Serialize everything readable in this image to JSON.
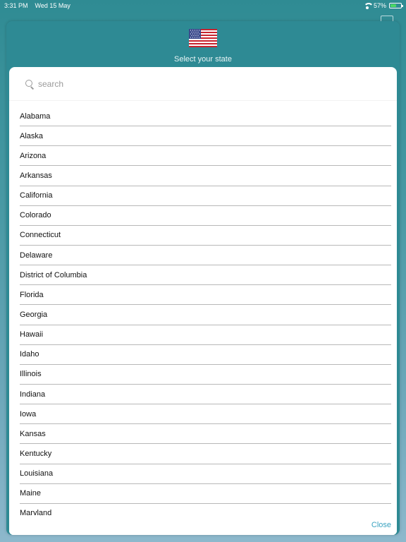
{
  "status_bar": {
    "time": "3:31 PM",
    "date": "Wed 15 May",
    "battery": "57%",
    "battery_level": 0.57
  },
  "modal": {
    "title": "Select your state",
    "flag_icon": "us-flag-icon"
  },
  "search": {
    "placeholder": "search",
    "value": ""
  },
  "states": [
    "Alabama",
    "Alaska",
    "Arizona",
    "Arkansas",
    "California",
    "Colorado",
    "Connecticut",
    "Delaware",
    "District of Columbia",
    "Florida",
    "Georgia",
    "Hawaii",
    "Idaho",
    "Illinois",
    "Indiana",
    "Iowa",
    "Kansas",
    "Kentucky",
    "Louisiana",
    "Maine",
    "Maryland"
  ],
  "footer": {
    "close_label": "Close"
  },
  "colors": {
    "modal_bg": "#2e8a94",
    "accent": "#3aa3c0"
  }
}
